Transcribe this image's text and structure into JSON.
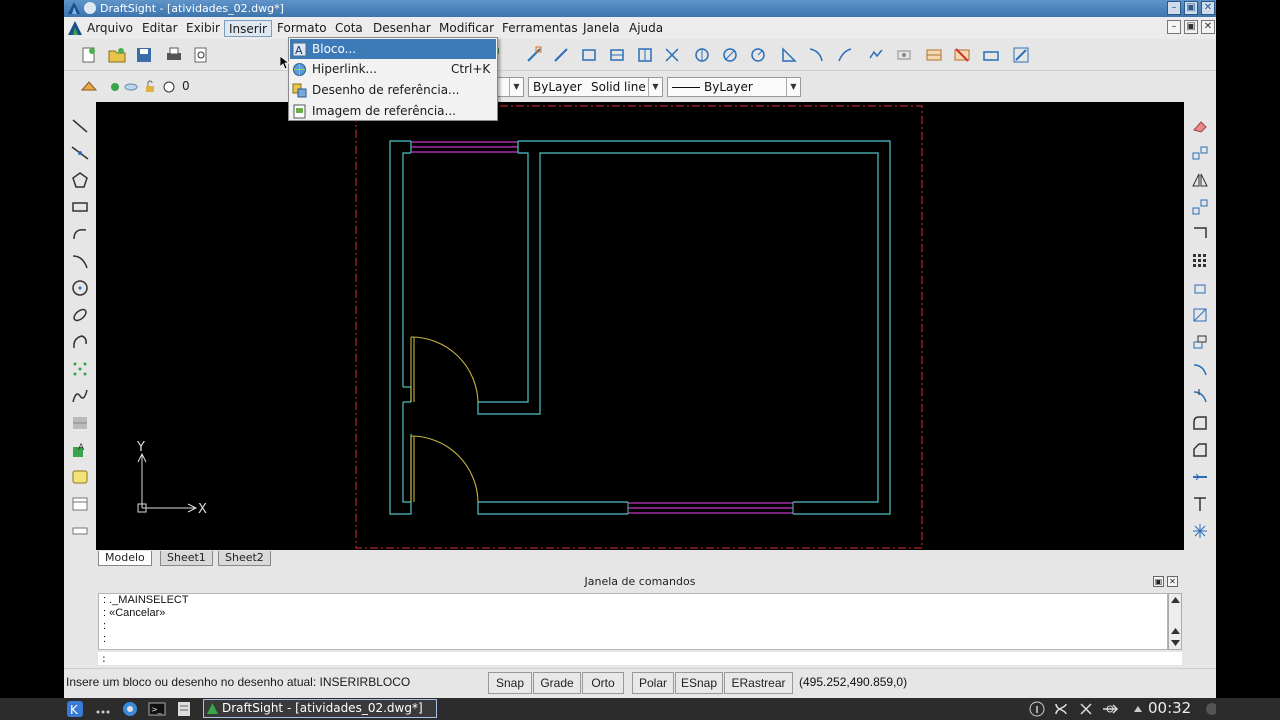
{
  "window": {
    "title": "DraftSight - [atividades_02.dwg*]",
    "controls": {
      "minimize": "–",
      "restore": "▣",
      "close": "✕"
    }
  },
  "menubar": {
    "items": [
      {
        "label": "Arquivo"
      },
      {
        "label": "Editar"
      },
      {
        "label": "Exibir"
      },
      {
        "label": "Inserir"
      },
      {
        "label": "Formato"
      },
      {
        "label": "Cota"
      },
      {
        "label": "Desenhar"
      },
      {
        "label": "Modificar"
      },
      {
        "label": "Ferramentas"
      },
      {
        "label": "Janela"
      },
      {
        "label": "Ajuda"
      }
    ],
    "active_index": 3
  },
  "insert_menu": {
    "items": [
      {
        "label": "Bloco...",
        "shortcut": "",
        "icon": "block-icon"
      },
      {
        "label": "Hiperlink...",
        "shortcut": "Ctrl+K",
        "icon": "hyperlink-icon"
      },
      {
        "label": "Desenho de referência...",
        "shortcut": "",
        "icon": "reference-drawing-icon"
      },
      {
        "label": "Imagem de referência...",
        "shortcut": "",
        "icon": "reference-image-icon"
      }
    ],
    "highlighted_index": 0
  },
  "properties": {
    "layer_name": "0",
    "layer_combo_tail": "ayer",
    "color": "ByLayer",
    "linetype": "Solid line",
    "lineweight": "ByLayer"
  },
  "sheet_tabs": [
    {
      "label": "Modelo"
    },
    {
      "label": "Sheet1"
    },
    {
      "label": "Sheet2"
    }
  ],
  "command_window": {
    "title": "Janela de comandos",
    "lines": [
      ": ._MAINSELECT",
      ": «Cancelar»",
      ":",
      ":"
    ],
    "prompt": ":"
  },
  "statusbar": {
    "message": "Insere um bloco ou desenho no desenho atual:  INSERIRBLOCO",
    "buttons": [
      "Snap",
      "Grade",
      "Orto",
      "Polar",
      "ESnap",
      "ERastrear"
    ],
    "coordinates": "(495.252,490.859,0)"
  },
  "ucs": {
    "x_label": "X",
    "y_label": "Y"
  },
  "taskbar": {
    "window_title": "DraftSight - [atividades_02.dwg*]",
    "clock": "00:32"
  },
  "colors": {
    "wall": "#4fc3c8",
    "window": "#c838c8",
    "door": "#c8b43c",
    "border": "#e03030",
    "highlight": "#3d7ab8"
  }
}
